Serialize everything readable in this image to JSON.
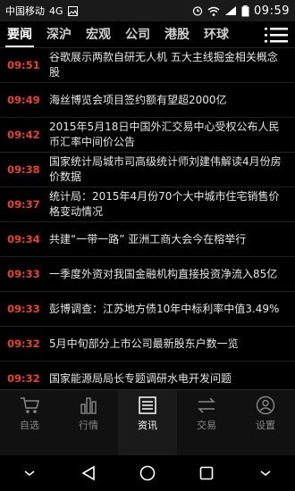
{
  "status_bar": {
    "carrier": "中国移动",
    "network": "4G",
    "time": "09:59"
  },
  "tabs": [
    {
      "label": "要闻",
      "active": true
    },
    {
      "label": "深沪",
      "active": false
    },
    {
      "label": "宏观",
      "active": false
    },
    {
      "label": "公司",
      "active": false
    },
    {
      "label": "港股",
      "active": false
    },
    {
      "label": "环球",
      "active": false
    }
  ],
  "news": [
    {
      "time": "09:51",
      "title": "谷歌展示两款自研无人机 五大主线掘金相关概念股"
    },
    {
      "time": "09:49",
      "title": "海丝博览会项目签约额有望超2000亿"
    },
    {
      "time": "09:42",
      "title": "2015年5月18日中国外汇交易中心受权公布人民币汇率中间价公告"
    },
    {
      "time": "09:38",
      "title": "国家统计局城市司高级统计师刘建伟解读4月份房价数据"
    },
    {
      "time": "09:37",
      "title": "统计局：2015年4月份70个大中城市住宅销售价格变动情况"
    },
    {
      "time": "09:34",
      "title": "共建“一带一路” 亚洲工商大会今在榕举行"
    },
    {
      "time": "09:33",
      "title": "一季度外资对我国金融机构直接投资净流入85亿"
    },
    {
      "time": "09:33",
      "title": "彭博调查：江苏地方债10年中标利率中值3.49%"
    },
    {
      "time": "09:32",
      "title": "5月中旬部分上市公司最新股东户数一览"
    },
    {
      "time": "09:32",
      "title": "国家能源局局长专题调研水电开发问题"
    }
  ],
  "bottom_nav": [
    {
      "label": "自选",
      "icon": "cart-icon",
      "active": false
    },
    {
      "label": "行情",
      "icon": "bar-chart-icon",
      "active": false
    },
    {
      "label": "资讯",
      "icon": "news-icon",
      "active": true
    },
    {
      "label": "交易",
      "icon": "exchange-icon",
      "active": false
    },
    {
      "label": "设置",
      "icon": "user-icon",
      "active": false
    }
  ],
  "colors": {
    "time_red": "#e8412c",
    "background": "#000000"
  }
}
